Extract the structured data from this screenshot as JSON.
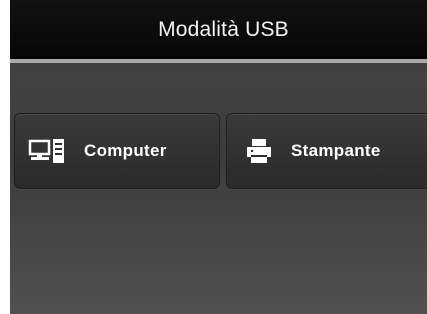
{
  "header": {
    "title": "Modalità USB"
  },
  "options": [
    {
      "label": "Computer",
      "icon": "computer-icon"
    },
    {
      "label": "Stampante",
      "icon": "printer-icon"
    }
  ],
  "colors": {
    "title_bar": "#0c0c0c",
    "divider": "#a9a9a9",
    "panel": "#424242",
    "button": "#333333",
    "text": "#ffffff"
  }
}
